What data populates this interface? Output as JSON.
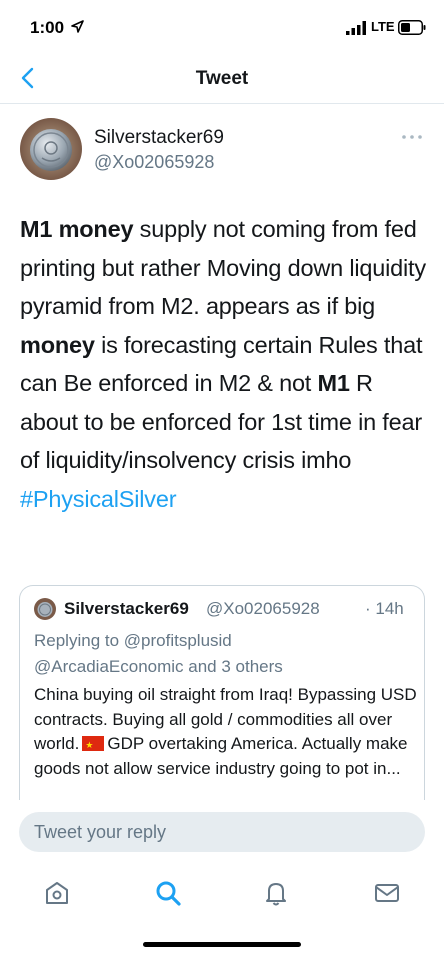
{
  "status_bar": {
    "time": "1:00",
    "network": "LTE"
  },
  "nav": {
    "title": "Tweet"
  },
  "author": {
    "name": "Silverstacker69",
    "handle": "@Xo02065928"
  },
  "tweet": {
    "segments": [
      {
        "text": "M1 money",
        "bold": true
      },
      {
        "text": " supply not coming from fed printing but rather Moving down liquidity pyramid from M2. appears as if big ",
        "bold": false
      },
      {
        "text": "money",
        "bold": true
      },
      {
        "text": " is forecasting certain Rules that can Be enforced in M2 & not ",
        "bold": false
      },
      {
        "text": "M1",
        "bold": true
      },
      {
        "text": " R about to be enforced for 1st time in fear of liquidity/insolvency crisis imho ",
        "bold": false
      }
    ],
    "hashtag": "#PhysicalSilver"
  },
  "quoted_tweet": {
    "name": "Silverstacker69",
    "handle": "@Xo02065928",
    "time": "· 14h",
    "replying_prefix": "Replying to ",
    "replying_first": "@profitsplusid",
    "replying_rest": "@ArcadiaEconomic and 3 others",
    "text_before_flag": "China buying oil straight from Iraq! Bypassing USD contracts. Buying all gold / commodities all over world.",
    "text_after_flag": "GDP overtaking America. Actually make goods not allow service industry going to pot in..."
  },
  "reply_box": {
    "placeholder": "Tweet your reply"
  },
  "colors": {
    "accent": "#1da1f2",
    "secondary_text": "#657786",
    "primary_text": "#14171a",
    "divider": "#e1e8ed"
  },
  "tabs": [
    {
      "icon": "home-icon"
    },
    {
      "icon": "search-icon"
    },
    {
      "icon": "notifications-bell-icon"
    },
    {
      "icon": "messages-envelope-icon"
    }
  ]
}
